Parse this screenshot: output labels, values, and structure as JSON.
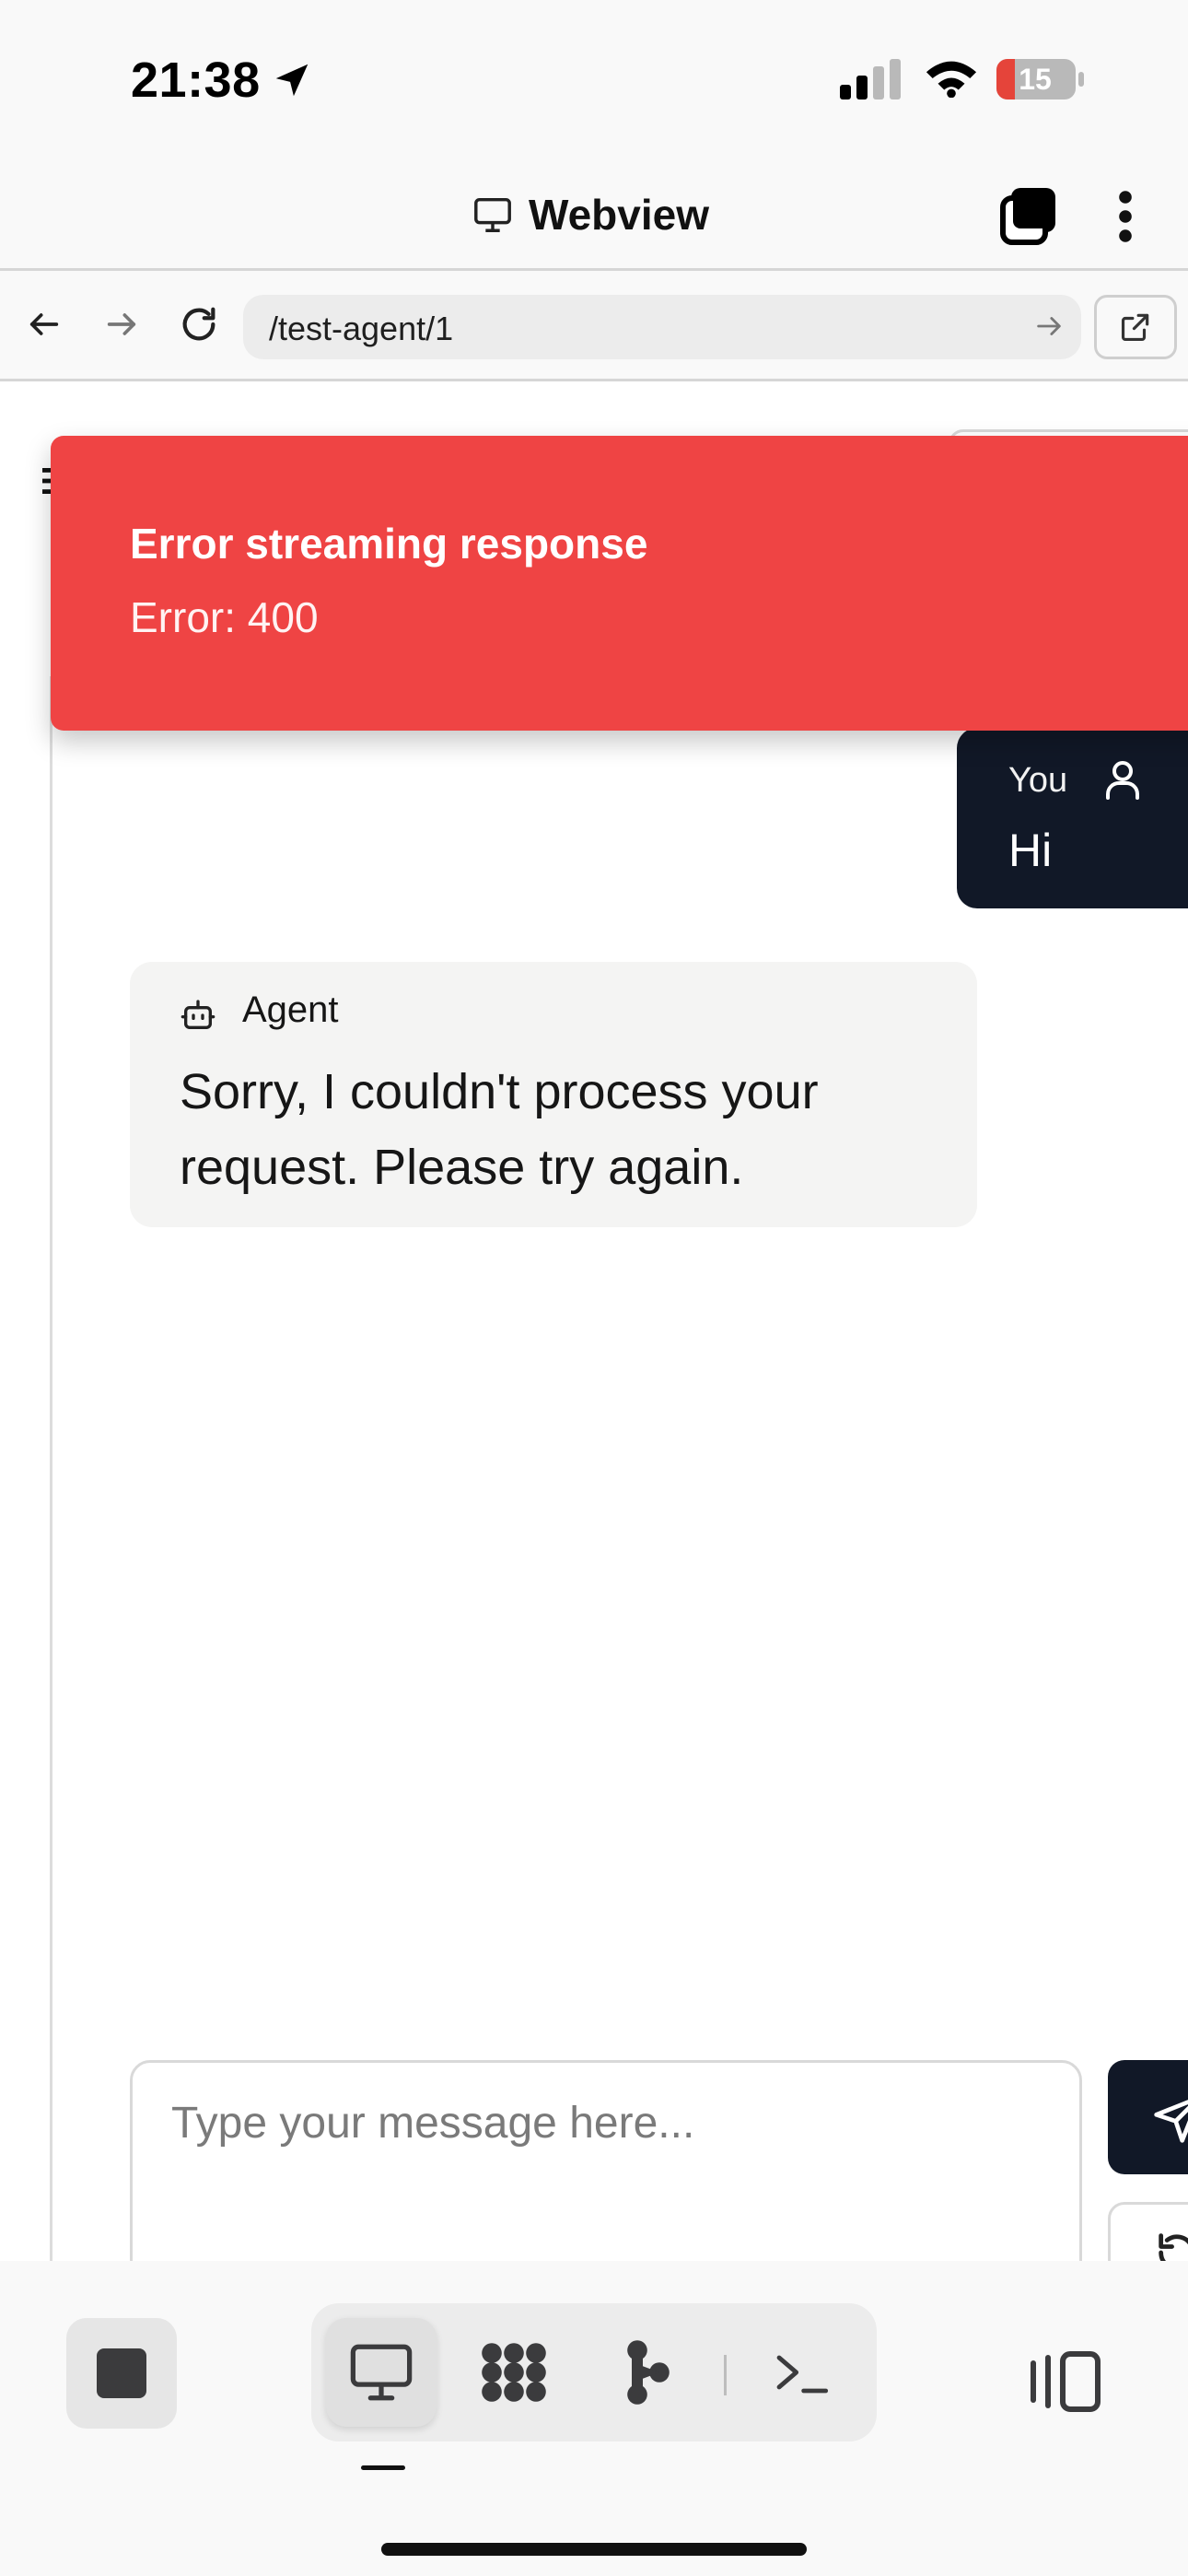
{
  "status_bar": {
    "time": "21:38",
    "battery_level": "15",
    "icons": [
      "location-arrow-icon",
      "signal-icon",
      "wifi-icon",
      "battery-icon"
    ]
  },
  "webview": {
    "title": "Webview",
    "icons": [
      "monitor-icon",
      "tabs-icon",
      "more-vertical-icon"
    ]
  },
  "url_bar": {
    "url": "/test-agent/1",
    "icons": [
      "back-arrow-icon",
      "forward-arrow-icon",
      "reload-icon",
      "go-arrow-icon",
      "external-link-icon"
    ]
  },
  "toast": {
    "title": "Error streaming response",
    "description": "Error: 400",
    "color": "#ef4444"
  },
  "chat": {
    "user_message": {
      "label": "You",
      "text": "Hi",
      "icon": "user-icon",
      "color": "#111827"
    },
    "agent_message": {
      "label": "Agent",
      "text": "Sorry, I couldn't process your request. Please try again.",
      "icon": "bot-icon"
    },
    "input": {
      "placeholder": "Type your message here..."
    },
    "send_icon": "send-icon",
    "reset_icon": "reset-icon"
  },
  "bottom_toolbar": {
    "active_mode": "desktop",
    "modes": [
      "desktop-icon",
      "apps-icon",
      "branch-icon",
      "terminal-icon"
    ],
    "left_icon": "stop-icon",
    "right_icon": "split-view-icon"
  }
}
